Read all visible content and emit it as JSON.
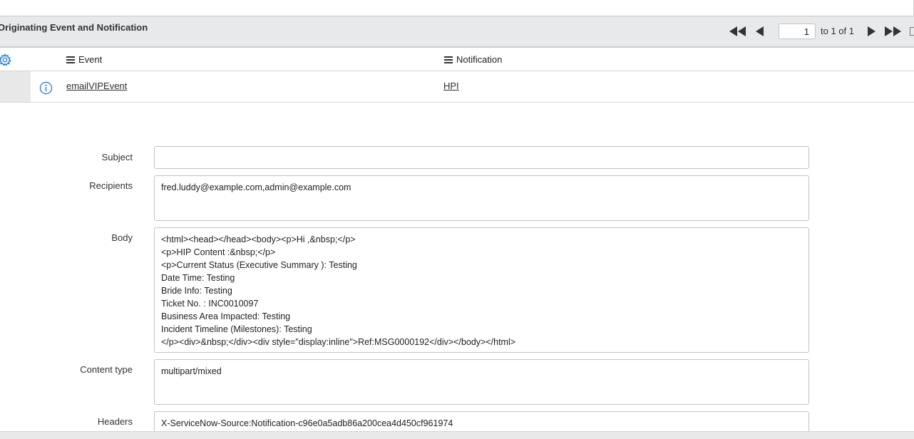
{
  "list": {
    "title": "Originating Event and Notification",
    "pager": {
      "current_page": "1",
      "of_text": "to 1 of 1"
    },
    "columns": [
      {
        "label": "Event"
      },
      {
        "label": "Notification"
      }
    ],
    "rows": [
      {
        "event": "emailVIPEvent",
        "notification": "HPI"
      }
    ]
  },
  "form": {
    "subject": {
      "label": "Subject",
      "value": ""
    },
    "recipients": {
      "label": "Recipients",
      "value": "fred.luddy@example.com,admin@example.com"
    },
    "body": {
      "label": "Body",
      "value": "<html><head></head><body><p>Hi ,&nbsp;</p>\n<p>HIP Content :&nbsp;</p>\n<p>Current Status (Executive Summary ):  Testing\nDate Time:  Testing\nBride Info:  Testing\nTicket No. : INC0010097\nBusiness Area Impacted:  Testing\nIncident Timeline (Milestones):  Testing\n</p><div>&nbsp;</div><div style=\"display:inline\">Ref:MSG0000192</div></body></html>"
    },
    "content_type": {
      "label": "Content type",
      "value": "multipart/mixed"
    },
    "headers": {
      "label": "Headers",
      "value": "X-ServiceNow-Source:Notification-c96e0a5adb86a200cea4d450cf961974"
    }
  },
  "icons": {
    "gear": "gear-icon",
    "info": "info-icon",
    "first": "first-page-icon",
    "prev": "previous-page-icon",
    "next": "next-page-icon",
    "last": "last-page-icon",
    "column_menu": "hamburger-icon"
  },
  "colors": {
    "header_bg": "#e7e9eb",
    "info_icon": "#2d7ec7",
    "gear_icon": "#2d7ec7"
  }
}
